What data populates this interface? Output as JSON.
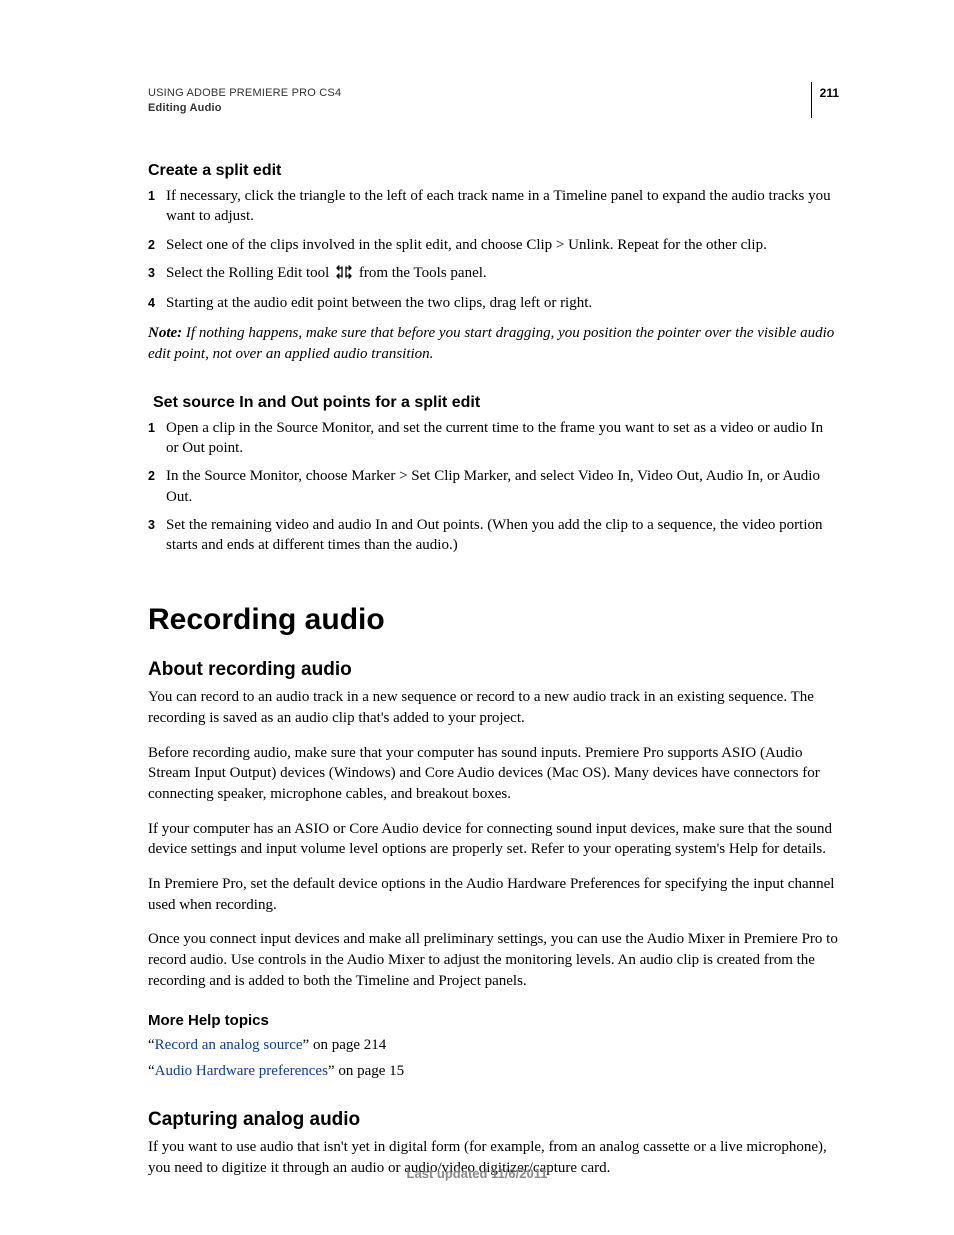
{
  "header": {
    "line1": "USING ADOBE PREMIERE PRO CS4",
    "line2": "Editing Audio",
    "page_number": "211"
  },
  "section_a": {
    "title": "Create a split edit",
    "steps": [
      "If necessary, click the triangle to the left of each track name in a Timeline panel to expand the audio tracks you want to adjust.",
      "Select one of the clips involved in the split edit, and choose Clip > Unlink. Repeat for the other clip.",
      {
        "pre": "Select the Rolling Edit tool ",
        "post": " from the Tools panel."
      },
      "Starting at the audio edit point between the two clips, drag left or right."
    ],
    "note_label": "Note:",
    "note_text": " If nothing happens, make sure that before you start dragging, you position the pointer over the visible audio edit point, not over an applied audio transition."
  },
  "section_b": {
    "title": " Set source In and Out points for a split edit",
    "steps": [
      "Open a clip in the Source Monitor, and set the current time to the frame you want to set as a video or audio In or Out point.",
      "In the Source Monitor, choose Marker > Set Clip Marker, and select Video In, Video Out, Audio In, or Audio Out.",
      "Set the remaining video and audio In and Out points. (When you add the clip to a sequence, the video portion starts and ends at different times than the audio.)"
    ]
  },
  "chapter_title": "Recording audio",
  "section_c": {
    "title": "About recording audio",
    "paragraphs": [
      "You can record to an audio track in a new sequence or record to a new audio track in an existing sequence. The recording is saved as an audio clip that's added to your project.",
      "Before recording audio, make sure that your computer has sound inputs. Premiere Pro supports ASIO (Audio Stream Input Output) devices (Windows) and Core Audio devices (Mac OS). Many devices have connectors for connecting speaker, microphone cables, and breakout boxes.",
      "If your computer has an ASIO or Core Audio device for connecting sound input devices, make sure that the sound device settings and input volume level options are properly set. Refer to your operating system's Help for details.",
      "In Premiere Pro, set the default device options in the Audio Hardware Preferences for specifying the input channel used when recording.",
      "Once you connect input devices and make all preliminary settings, you can use the Audio Mixer in Premiere Pro to record audio. Use controls in the Audio Mixer to adjust the monitoring levels. An audio clip is created from the recording and is added to both the Timeline and Project panels."
    ],
    "more_help_title": "More Help topics",
    "xrefs": [
      {
        "q1": "“",
        "link": "Record an analog source",
        "tail": "” on page 214"
      },
      {
        "q1": "“",
        "link": "Audio Hardware preferences",
        "tail": "” on page 15"
      }
    ]
  },
  "section_d": {
    "title": "Capturing analog audio",
    "paragraphs": [
      "If you want to use audio that isn't yet in digital form (for example, from an analog cassette or a live microphone), you need to digitize it through an audio or audio/video digitizer/capture card."
    ]
  },
  "footer": "Last updated 11/6/2011"
}
